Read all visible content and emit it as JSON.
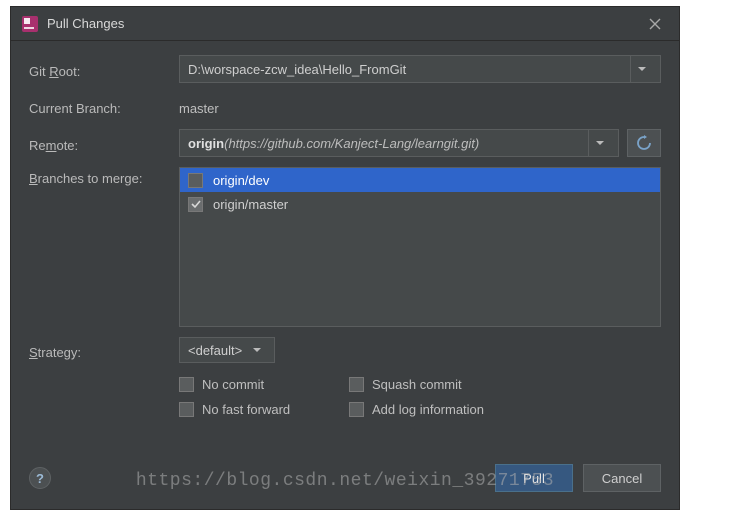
{
  "title": "Pull Changes",
  "labels": {
    "git_root": "Git Root:",
    "current_branch": "Current Branch:",
    "remote": "Remote:",
    "branches_to_merge": "Branches to merge:",
    "strategy": "Strategy:"
  },
  "git_root": {
    "value": "D:\\worspace-zcw_idea\\Hello_FromGit"
  },
  "current_branch": "master",
  "remote": {
    "name": "origin",
    "url": "https://github.com/Kanject-Lang/learngit.git"
  },
  "branches": [
    {
      "name": "origin/dev",
      "checked": false,
      "selected": true
    },
    {
      "name": "origin/master",
      "checked": true,
      "selected": false
    }
  ],
  "strategy": {
    "value": "<default>"
  },
  "options": {
    "no_commit": "No commit",
    "squash_commit": "Squash commit",
    "no_fast_forward": "No fast forward",
    "add_log_info": "Add log information"
  },
  "buttons": {
    "pull": "Pull",
    "cancel": "Cancel",
    "help": "?"
  },
  "watermark": "https://blog.csdn.net/weixin_39271753"
}
